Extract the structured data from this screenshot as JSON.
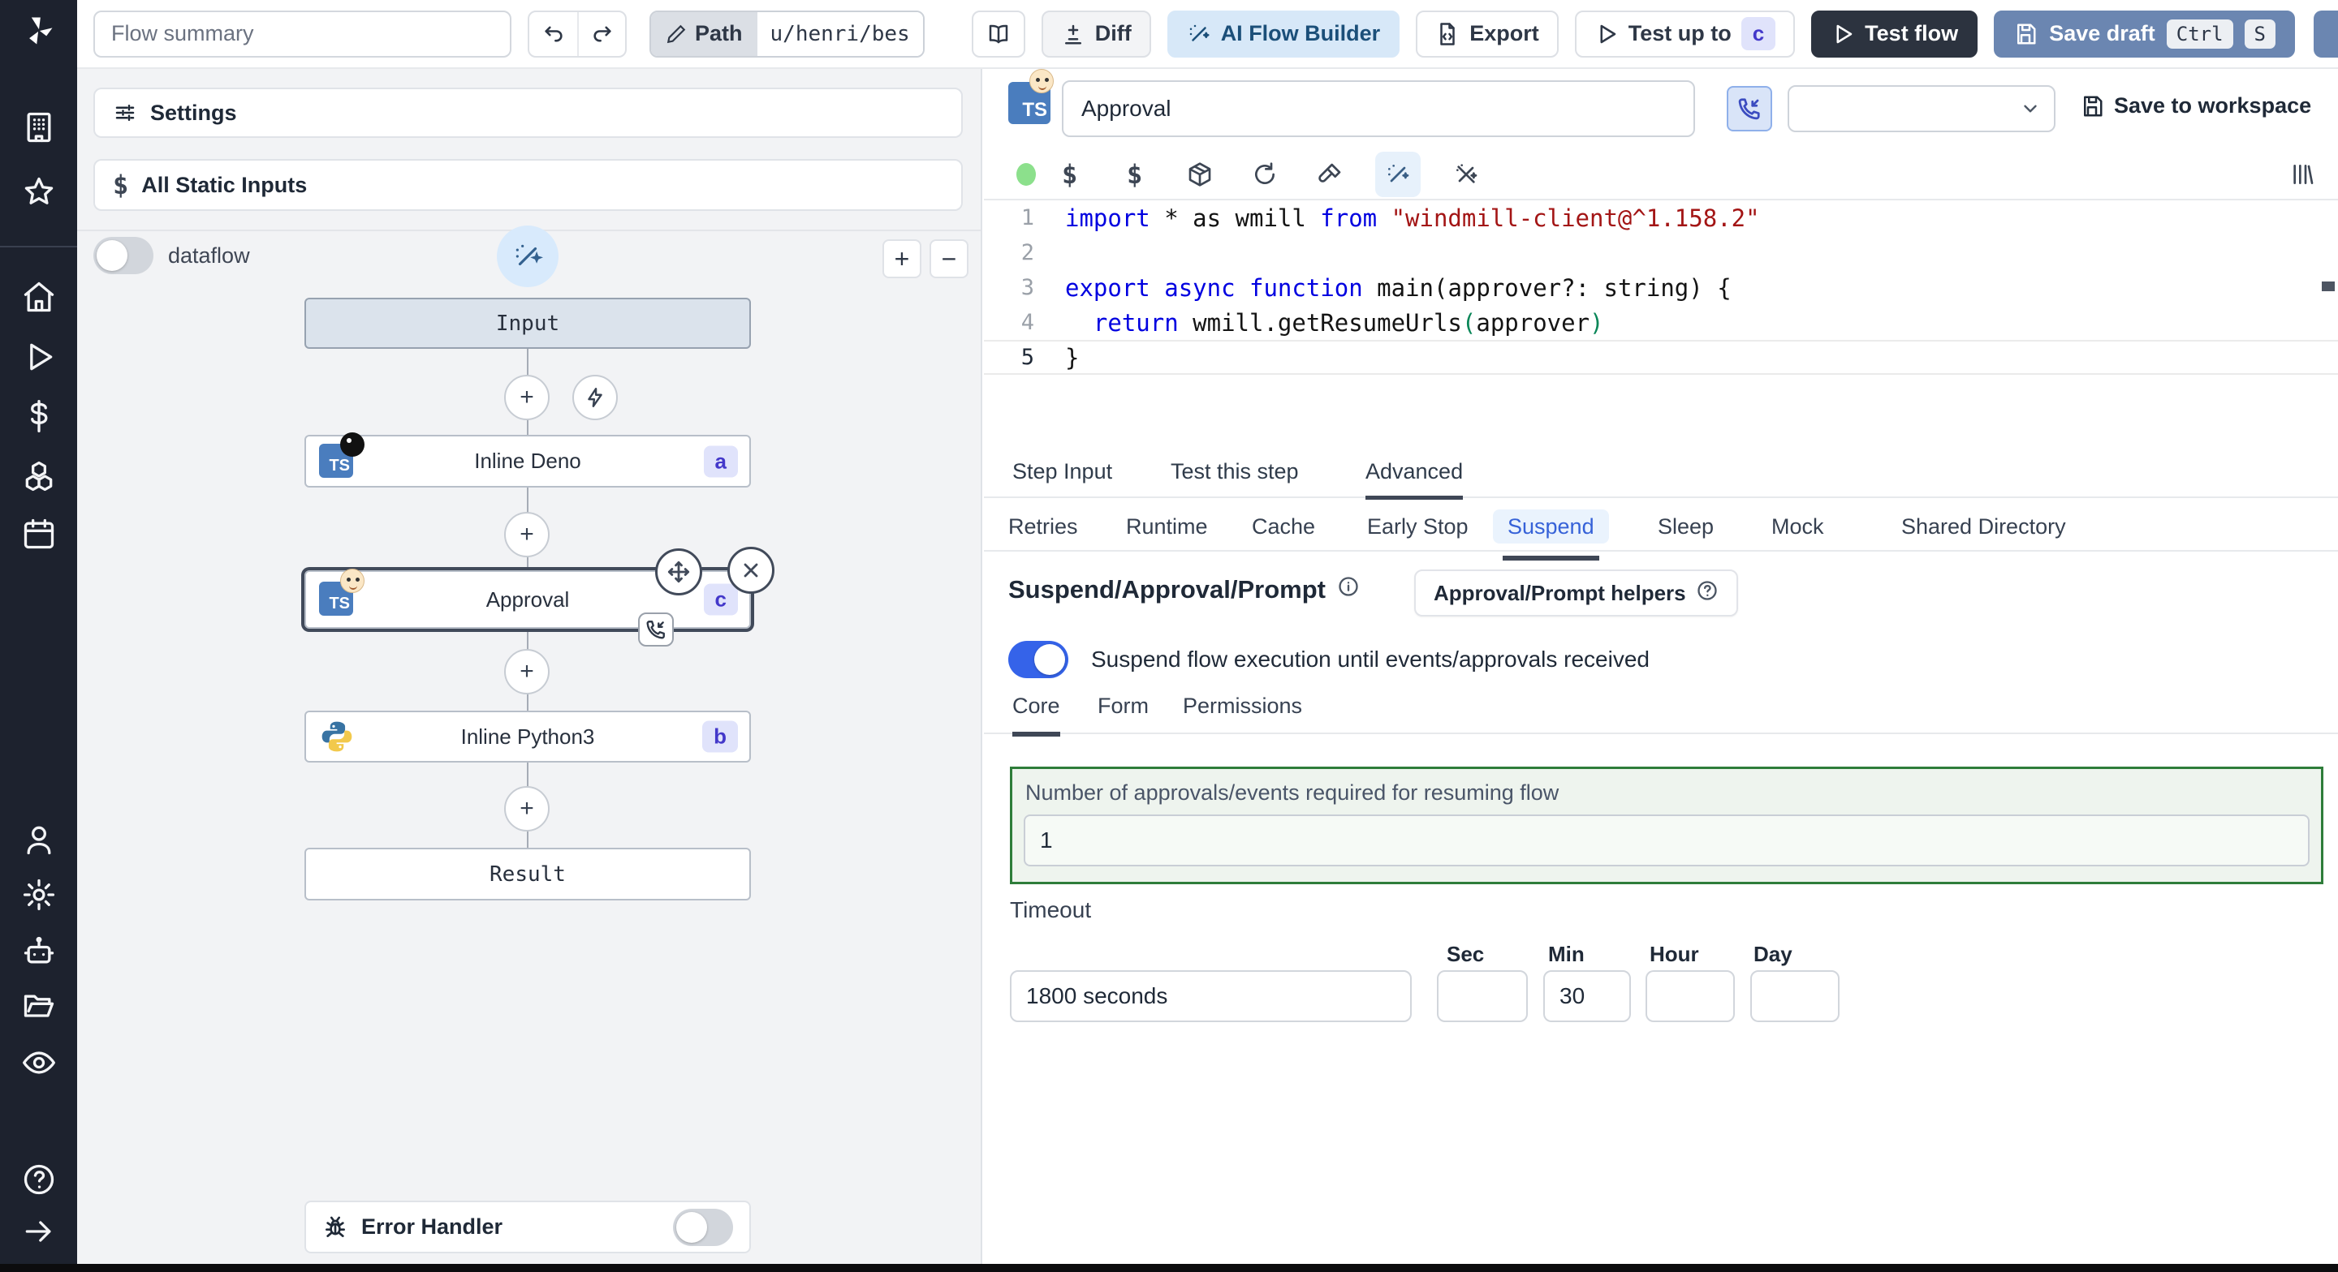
{
  "topbar": {
    "flow_summary_placeholder": "Flow summary",
    "path_label": "Path",
    "path_value": "u/henri/bes",
    "diff_label": "Diff",
    "ai_flow_builder_label": "AI Flow Builder",
    "export_label": "Export",
    "test_up_to_label": "Test up to",
    "test_up_to_badge": "c",
    "test_flow_label": "Test flow",
    "save_draft_label": "Save draft",
    "save_draft_kbd_1": "Ctrl",
    "save_draft_kbd_2": "S"
  },
  "left": {
    "settings_label": "Settings",
    "static_inputs_label": "All Static Inputs",
    "static_inputs_icon": "$",
    "dataflow_label": "dataflow",
    "zoom_in": "+",
    "zoom_out": "−",
    "error_handler_label": "Error Handler",
    "graph": {
      "input_label": "Input",
      "result_label": "Result",
      "nodes": [
        {
          "label": "Inline Deno",
          "badge": "a",
          "lang": "deno-typescript"
        },
        {
          "label": "Approval",
          "badge": "c",
          "lang": "typescript-approval"
        },
        {
          "label": "Inline Python3",
          "badge": "b",
          "lang": "python3"
        }
      ],
      "ts_logo_text": "TS"
    }
  },
  "step": {
    "name": "Approval",
    "save_to_workspace_label": "Save to workspace",
    "status_dot_color": "#8ce08c"
  },
  "code": {
    "numbers": [
      "1",
      "2",
      "3",
      "4",
      "5"
    ],
    "l1": {
      "k1": "import",
      "t1": " * as wmill ",
      "k2": "from",
      "s1": " \"windmill-client@^1.158.2\""
    },
    "l3": {
      "k1": "export",
      "sp1": " ",
      "k2": "async",
      "sp2": " ",
      "k3": "function",
      "t1": " main(approver?: string) {"
    },
    "l4": {
      "t0": "  ",
      "k1": "return",
      "t1": " wmill.getResumeUrls",
      "p1": "(",
      "t2": "approver",
      "p2": ")"
    },
    "l5": {
      "t1": "}"
    }
  },
  "tabs": {
    "items": [
      "Step Input",
      "Test this step",
      "Advanced"
    ],
    "active": "Advanced"
  },
  "advanced_tabs": {
    "items": [
      "Retries",
      "Runtime",
      "Cache",
      "Early Stop",
      "Suspend",
      "Sleep",
      "Mock",
      "Shared Directory"
    ],
    "active": "Suspend"
  },
  "suspend": {
    "title": "Suspend/Approval/Prompt",
    "helpers_label": "Approval/Prompt helpers",
    "toggle_label": "Suspend flow execution until events/approvals received",
    "toggle_on": true,
    "sub_tabs": [
      "Core",
      "Form",
      "Permissions"
    ],
    "active_sub_tab": "Core",
    "approvals_label": "Number of approvals/events required for resuming flow",
    "approvals_value": "1",
    "timeout_label": "Timeout",
    "timeout_value": "1800 seconds",
    "unit_labels": [
      "Sec",
      "Min",
      "Hour",
      "Day"
    ],
    "unit_values": {
      "sec": "",
      "min": "30",
      "hour": "",
      "day": ""
    }
  },
  "colors": {
    "accent_ai_button_bg": "#d7e8f8",
    "accent_ai_button_text": "#1b4f79",
    "badge_bg": "#e0e3fb",
    "badge_text": "#4338ca",
    "save_draft_bg": "#6b86b1",
    "dark_button_bg": "#2c333f",
    "toggle_on": "#3563e9",
    "green_border": "#2e7d3a",
    "rail_bg": "#1d222e"
  }
}
